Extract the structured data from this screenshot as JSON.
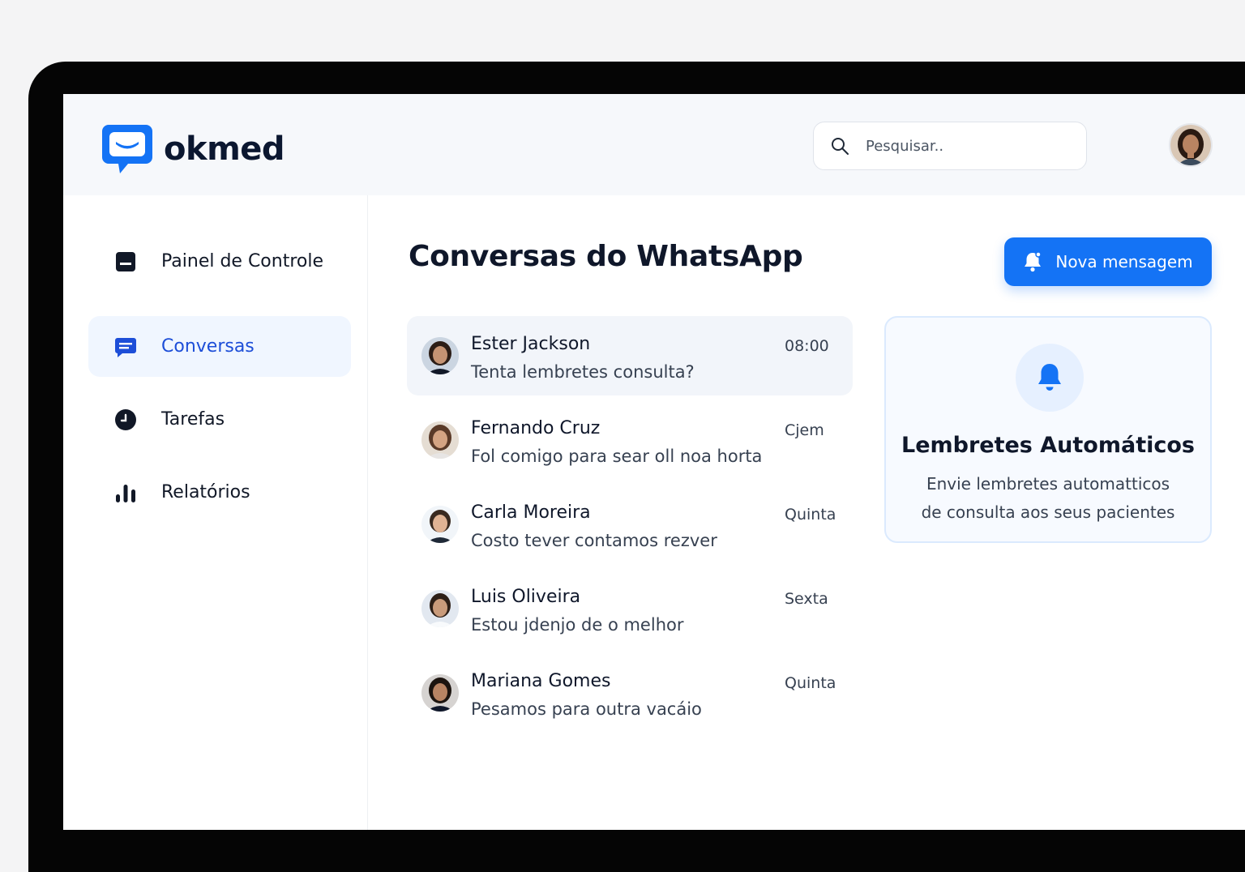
{
  "brand": {
    "name": "okmed",
    "accent": "#1473f5"
  },
  "header": {
    "search_placeholder": "Pesquisar..",
    "search_icon": "search-icon",
    "avatar_icon": "user-avatar"
  },
  "sidebar": {
    "items": [
      {
        "label": "Painel de Controle",
        "icon": "dashboard-icon",
        "active": false
      },
      {
        "label": "Conversas",
        "icon": "chat-icon",
        "active": true
      },
      {
        "label": "Tarefas",
        "icon": "clock-icon",
        "active": false
      },
      {
        "label": "Relatórios",
        "icon": "bar-chart-icon",
        "active": false
      }
    ]
  },
  "main": {
    "title": "Conversas do WhatsApp",
    "new_button_label": "Nova mensagem",
    "new_button_icon": "bell-icon"
  },
  "conversations": [
    {
      "name": "Ester Jackson",
      "message": "Tenta lembretes consulta?",
      "time": "08:00",
      "active": true
    },
    {
      "name": "Fernando Cruz",
      "message": "Fol comigo para sear oll noa horta",
      "time": "Cjem",
      "active": false
    },
    {
      "name": "Carla Moreira",
      "message": "Costo tever contamos rezver",
      "time": "Quinta",
      "active": false
    },
    {
      "name": "Luis Oliveira",
      "message": "Estou jdenjo de o melhor",
      "time": "Sexta",
      "active": false
    },
    {
      "name": "Mariana Gomes",
      "message": "Pesamos para outra vacáio",
      "time": "Quinta",
      "active": false
    }
  ],
  "reminder_card": {
    "icon": "bell-icon",
    "title": "Lembretes Automáticos",
    "description_line1": "Envie lembretes automatticos",
    "description_line2": "de consulta aos seus pacientes"
  }
}
